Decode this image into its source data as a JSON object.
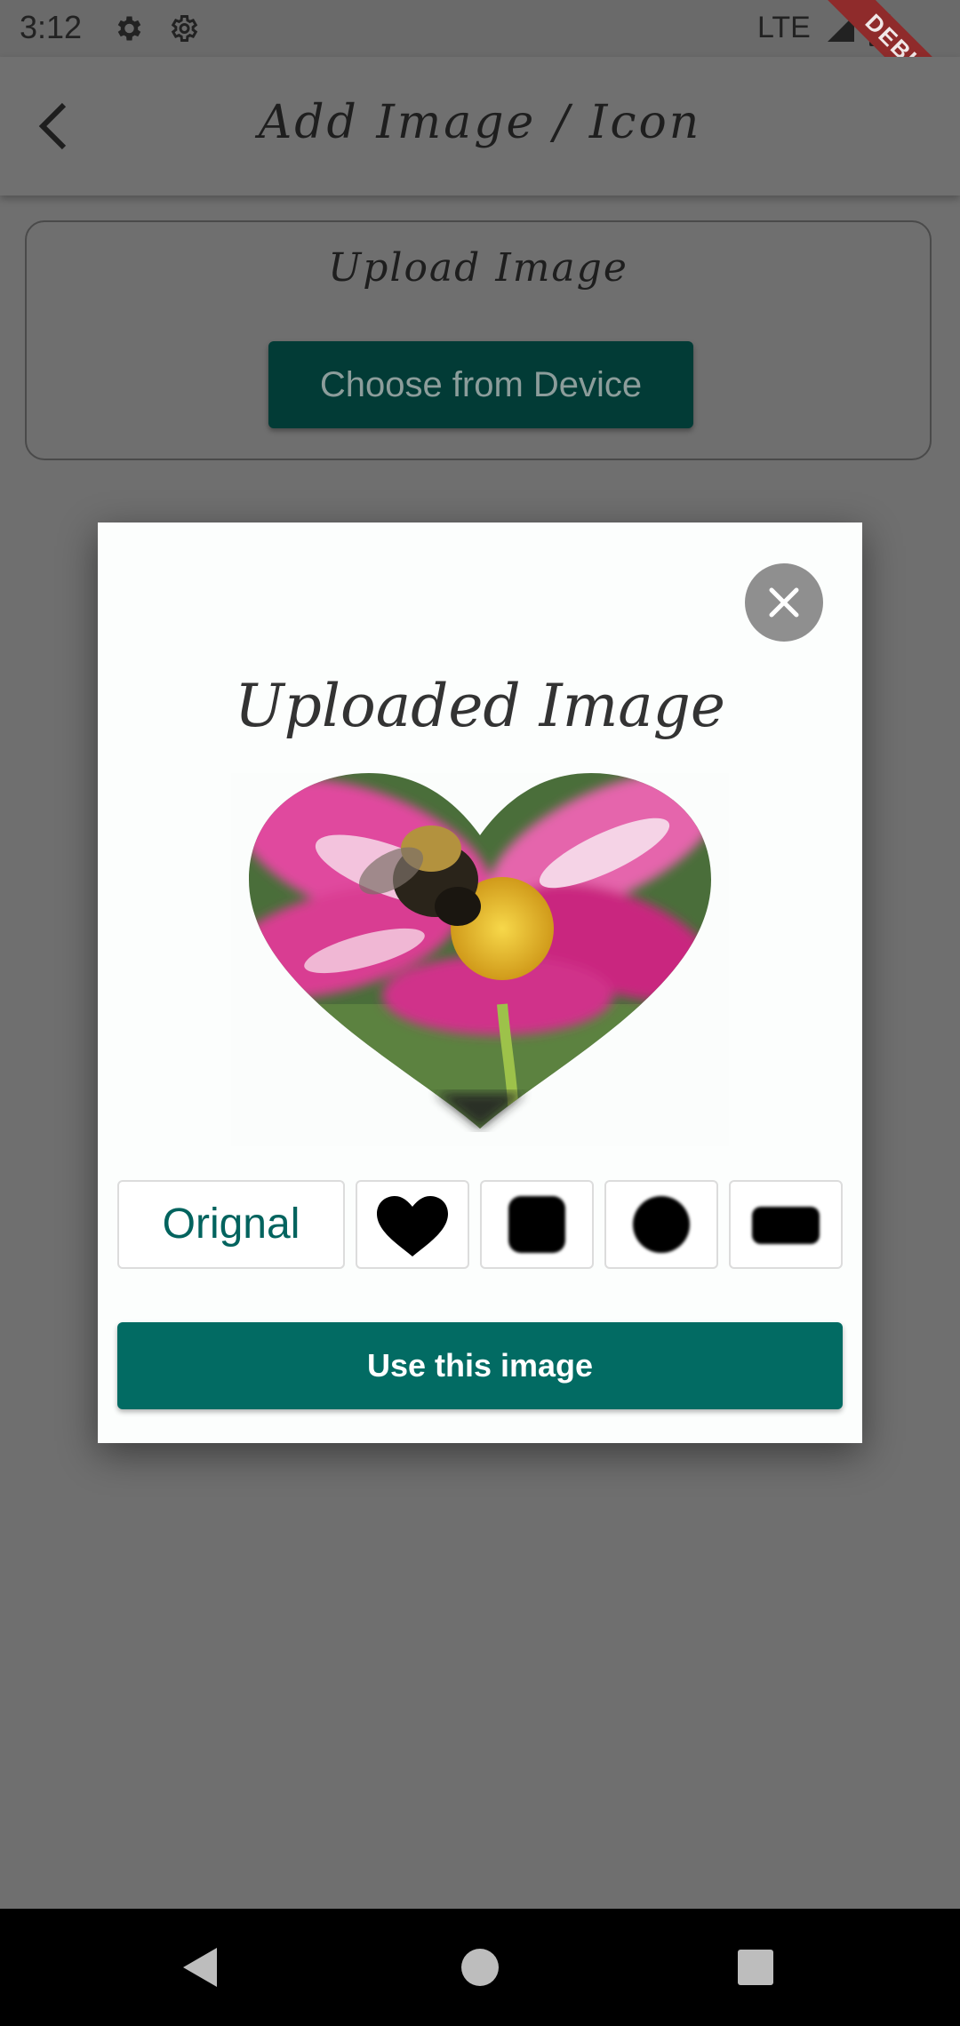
{
  "status_bar": {
    "time": "3:12",
    "network": "LTE",
    "icons": [
      "gear-icon",
      "gear-icon",
      "signal-icon",
      "battery-icon"
    ]
  },
  "debug_banner": "DEBUG",
  "app_bar": {
    "title": "Add Image / Icon",
    "back_icon": "arrow-back-icon"
  },
  "upload_card": {
    "title": "Upload Image",
    "choose_label": "Choose from Device"
  },
  "dialog": {
    "title": "Uploaded Image",
    "close_icon": "close-icon",
    "shape_options": [
      {
        "label": "Orignal",
        "icon": ""
      },
      {
        "label": "",
        "icon": "heart-icon"
      },
      {
        "label": "",
        "icon": "rounded-square-icon"
      },
      {
        "label": "",
        "icon": "circle-icon"
      },
      {
        "label": "",
        "icon": "rounded-rect-icon"
      }
    ],
    "use_label": "Use this image"
  },
  "colors": {
    "primary": "#026b63",
    "primary_dark": "#023b36",
    "scrim": "#6f6f6f",
    "debug_ribbon": "#8f2b2b"
  },
  "nav_bar": {
    "icons": [
      "back-triangle-icon",
      "home-circle-icon",
      "recents-square-icon"
    ]
  }
}
